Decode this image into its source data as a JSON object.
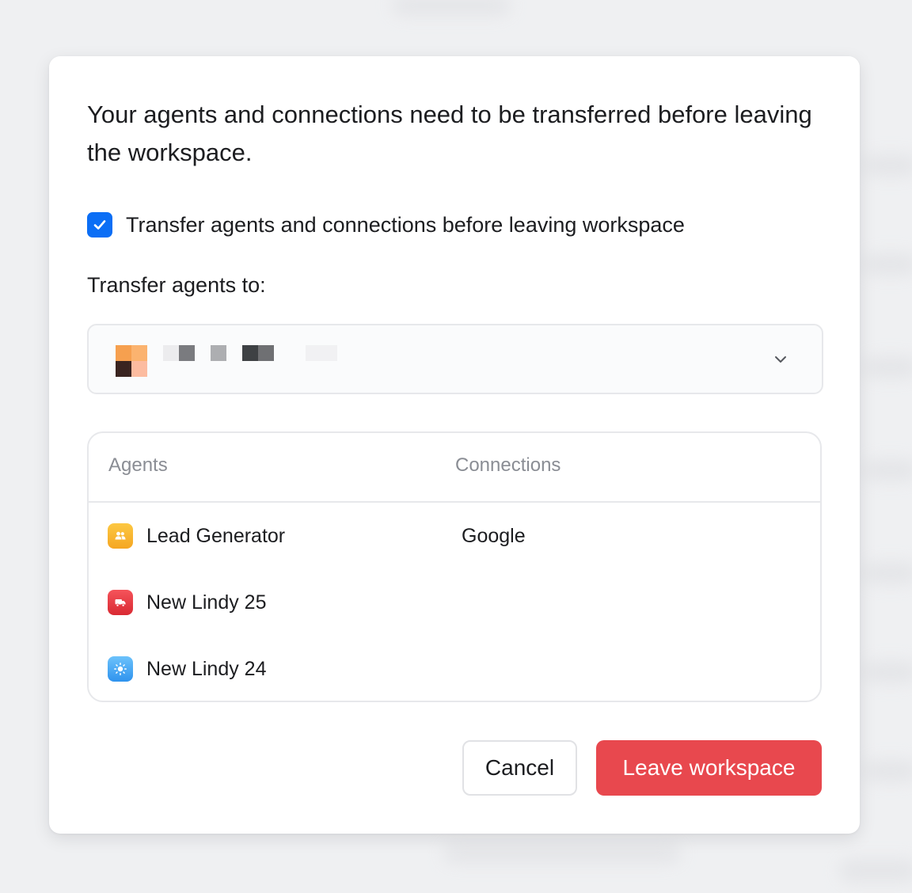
{
  "modal": {
    "heading": "Your agents and connections need to be transferred before leaving the workspace.",
    "transfer_checkbox": {
      "label": "Transfer agents and connections before leaving workspace",
      "checked": true
    },
    "transfer_to_label": "Transfer agents to:",
    "table": {
      "headers": {
        "agents": "Agents",
        "connections": "Connections"
      },
      "agents": [
        {
          "name": "Lead Generator",
          "icon": "users-icon",
          "color": "#f7b52c"
        },
        {
          "name": "New Lindy 25",
          "icon": "truck-icon",
          "color": "#e8353e"
        },
        {
          "name": "New Lindy 24",
          "icon": "sun-icon",
          "color": "#46a9f5"
        }
      ],
      "connections": [
        {
          "name": "Google"
        }
      ]
    },
    "buttons": {
      "cancel": "Cancel",
      "leave": "Leave workspace"
    }
  },
  "colors": {
    "accent": "#0b6ef5",
    "danger": "#e8484e"
  }
}
